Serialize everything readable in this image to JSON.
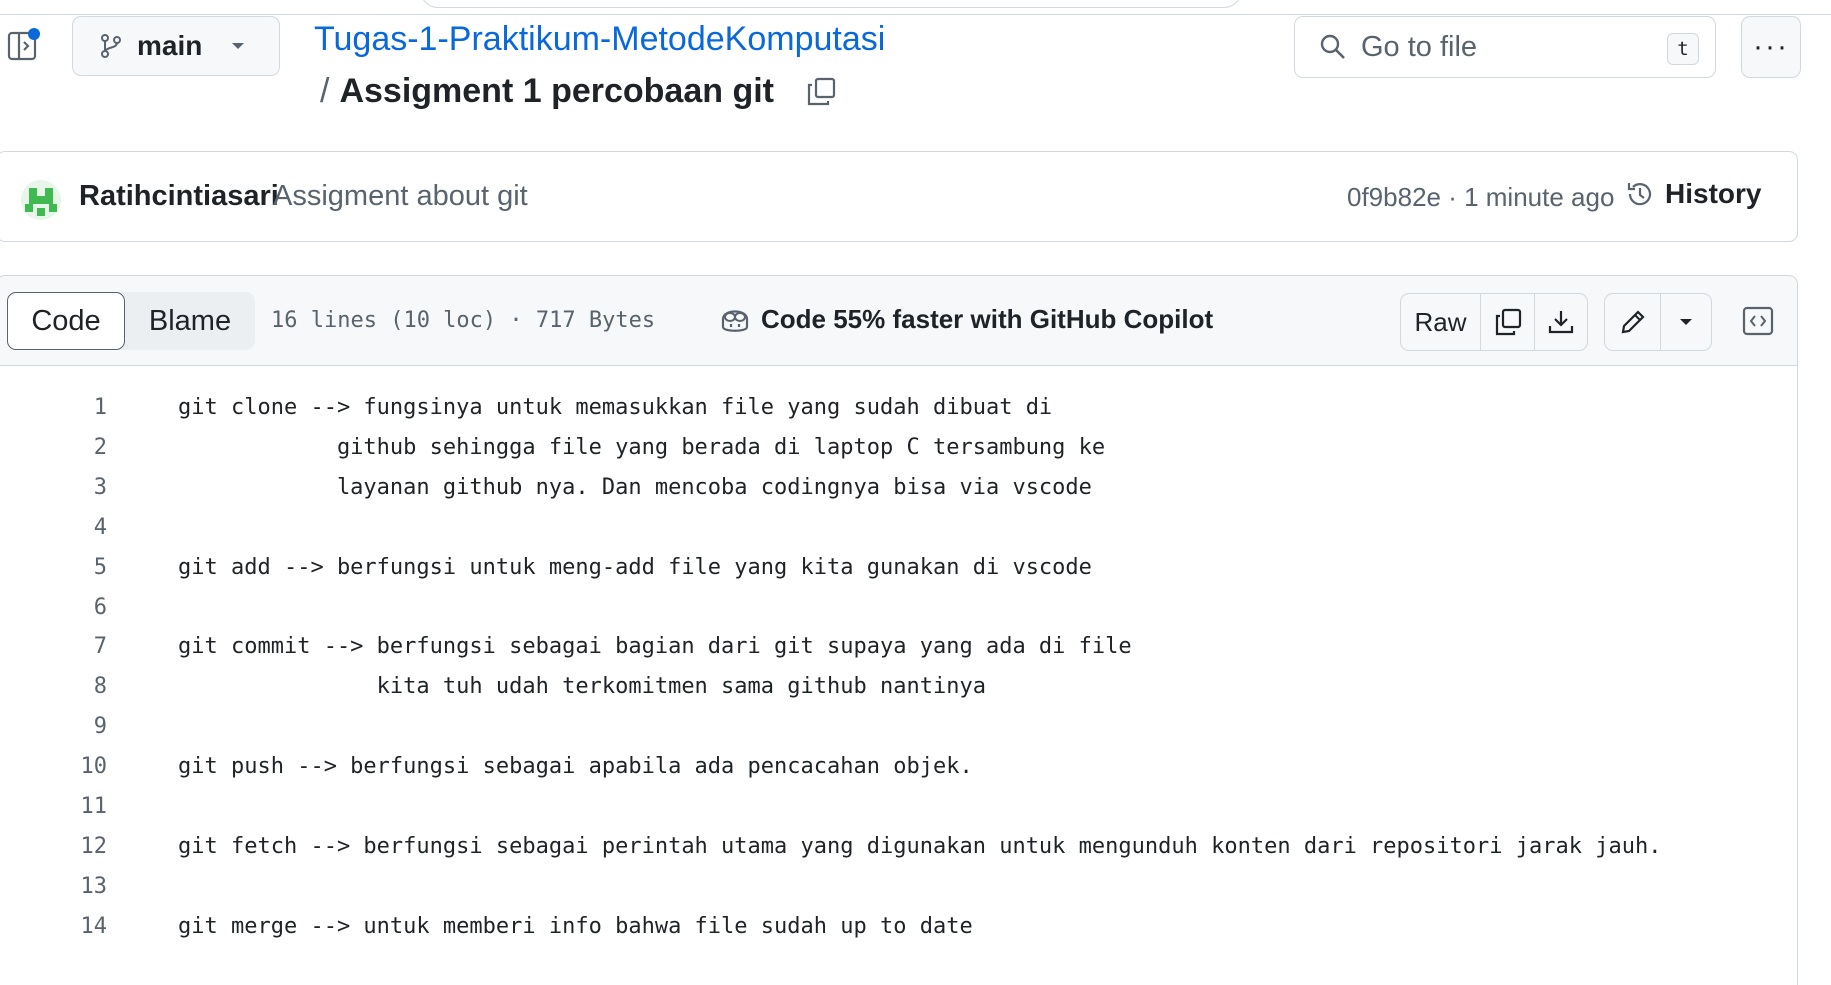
{
  "header": {
    "branch": "main",
    "repo_name": "Tugas-1-Praktikum-MetodeKomputasi",
    "separator": "/",
    "file_name": "Assigment 1 percobaan git",
    "search_placeholder": "Go to file",
    "search_shortcut": "t",
    "more_label": "···"
  },
  "commit": {
    "author": "Ratihcintiasari",
    "message": "Assigment about git",
    "meta": "0f9b82e · 1 minute ago",
    "history_label": "History"
  },
  "file_toolbar": {
    "tab_code": "Code",
    "tab_blame": "Blame",
    "stats": "16 lines (10 loc) · 717 Bytes",
    "copilot_text": "Code 55% faster with GitHub Copilot",
    "raw_label": "Raw"
  },
  "code_lines": [
    {
      "n": "1",
      "text": "git clone --> fungsinya untuk memasukkan file yang sudah dibuat di"
    },
    {
      "n": "2",
      "text": "            github sehingga file yang berada di laptop C tersambung ke"
    },
    {
      "n": "3",
      "text": "            layanan github nya. Dan mencoba codingnya bisa via vscode"
    },
    {
      "n": "4",
      "text": ""
    },
    {
      "n": "5",
      "text": "git add --> berfungsi untuk meng-add file yang kita gunakan di vscode"
    },
    {
      "n": "6",
      "text": ""
    },
    {
      "n": "7",
      "text": "git commit --> berfungsi sebagai bagian dari git supaya yang ada di file"
    },
    {
      "n": "8",
      "text": "               kita tuh udah terkomitmen sama github nantinya"
    },
    {
      "n": "9",
      "text": ""
    },
    {
      "n": "10",
      "text": "git push --> berfungsi sebagai apabila ada pencacahan objek."
    },
    {
      "n": "11",
      "text": ""
    },
    {
      "n": "12",
      "text": "git fetch --> berfungsi sebagai perintah utama yang digunakan untuk mengunduh konten dari repositori jarak jauh."
    },
    {
      "n": "13",
      "text": ""
    },
    {
      "n": "14",
      "text": "git merge --> untuk memberi info bahwa file sudah up to date"
    }
  ],
  "colors": {
    "link": "#0969da",
    "border": "#d1d9e0",
    "muted": "#59636e",
    "notification_dot": "#0969da"
  }
}
